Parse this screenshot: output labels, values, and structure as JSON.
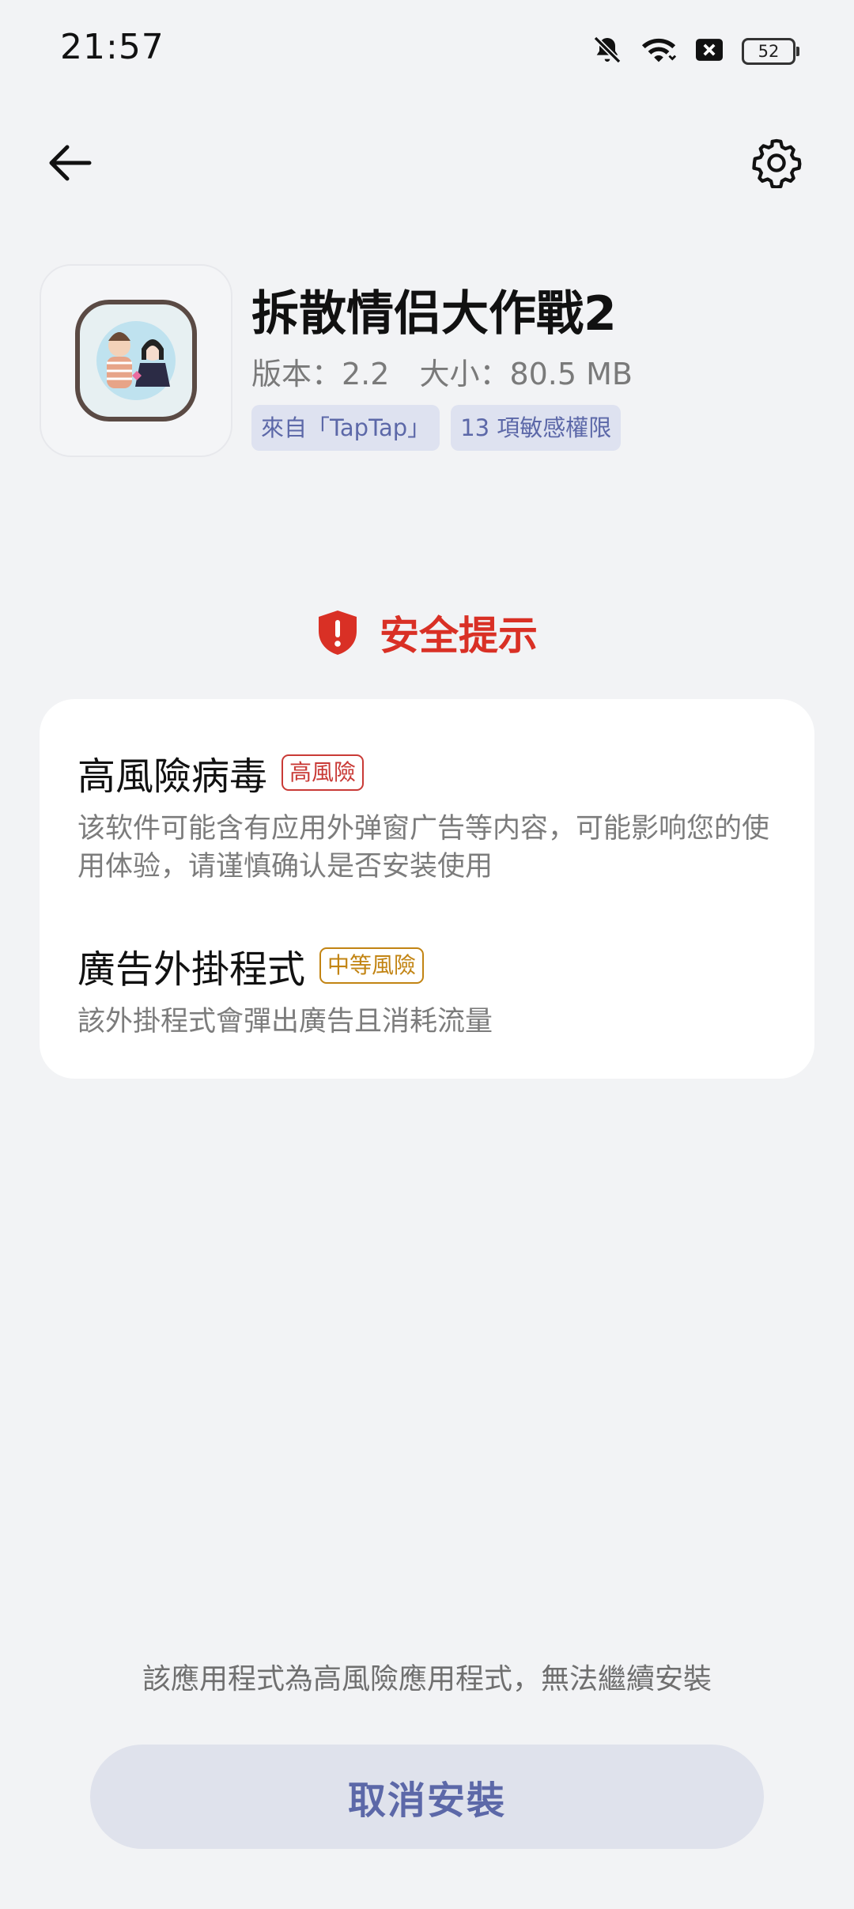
{
  "status_bar": {
    "time": "21:57",
    "battery": "52",
    "icons": [
      "bell-off-icon",
      "wifi-icon",
      "close-box-icon",
      "battery-icon"
    ]
  },
  "header": {
    "back_icon": "arrow-left-icon",
    "settings_icon": "gear-icon"
  },
  "app": {
    "name": "拆散情侣大作戰2",
    "version": "版本：2.2",
    "size": "大小：80.5 MB",
    "tags": [
      "來自「TapTap」",
      "13 項敏感權限"
    ]
  },
  "security": {
    "title": "安全提示",
    "icon": "shield-alert-icon",
    "risks": [
      {
        "name": "高風險病毒",
        "badge": "高風險",
        "level": "high",
        "description": "该软件可能含有应用外弹窗广告等内容，可能影响您的使用体验，请谨慎确认是否安装使用"
      },
      {
        "name": "廣告外掛程式",
        "badge": "中等風險",
        "level": "medium",
        "description": "該外掛程式會彈出廣告且消耗流量"
      }
    ]
  },
  "footer": {
    "notice": "該應用程式為高風險應用程式，無法繼續安裝",
    "cancel_label": "取消安裝"
  },
  "colors": {
    "background": "#f2f3f5",
    "danger": "#d93025",
    "warning": "#c28413",
    "accent": "#5c68a8",
    "chip_bg": "#dee2f0"
  }
}
